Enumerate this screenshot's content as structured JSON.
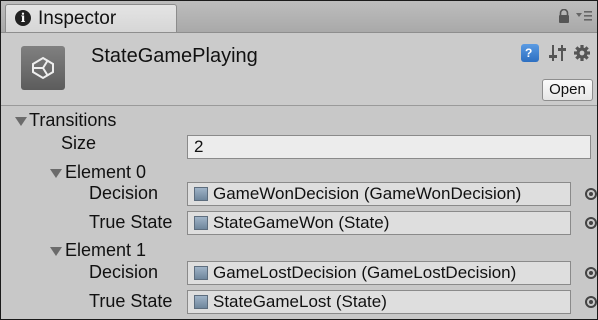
{
  "tab": {
    "label": "Inspector",
    "info_glyph": "i"
  },
  "header": {
    "object_name": "StateGamePlaying",
    "open_label": "Open",
    "help_glyph": "?"
  },
  "transitions": {
    "label": "Transitions",
    "size_label": "Size",
    "size_value": "2",
    "elements": [
      {
        "label": "Element 0",
        "decision_label": "Decision",
        "decision_value": "GameWonDecision (GameWonDecision)",
        "true_state_label": "True State",
        "true_state_value": "StateGameWon (State)"
      },
      {
        "label": "Element 1",
        "decision_label": "Decision",
        "decision_value": "GameLostDecision (GameLostDecision)",
        "true_state_label": "True State",
        "true_state_value": "StateGameLost (State)"
      }
    ]
  },
  "icons": {
    "tab": [
      "info-icon",
      "lock-icon",
      "tab-menu-icon"
    ],
    "header": [
      "unity-object-icon",
      "help-icon",
      "preset-settings-icon",
      "gear-icon"
    ],
    "fields": [
      "scriptable-object-icon",
      "object-picker-icon"
    ]
  },
  "colors": {
    "panel": "#c8c8c8",
    "field": "#dedede",
    "help_accent": "#2d6fc1"
  }
}
